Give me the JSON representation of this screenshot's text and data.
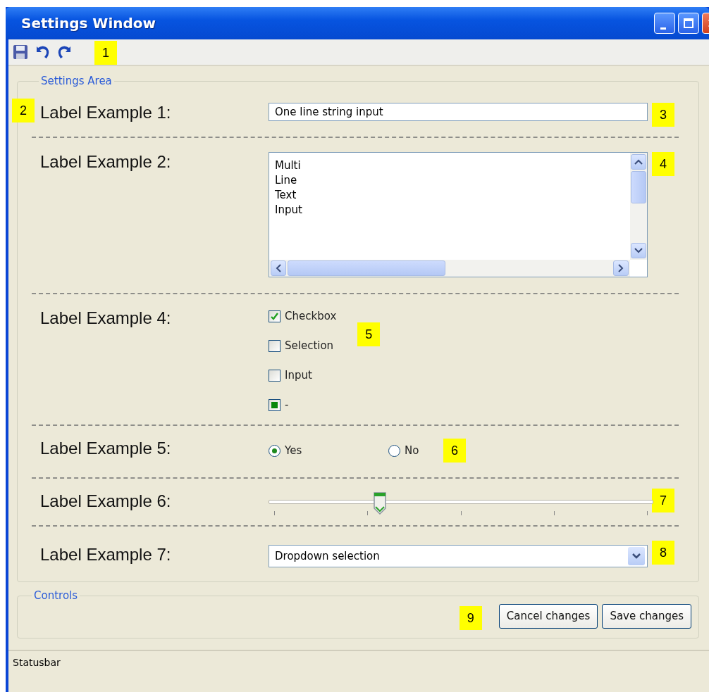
{
  "window": {
    "title": "Settings Window"
  },
  "toolbar": {
    "callout": "1"
  },
  "settings_area": {
    "legend": "Settings Area",
    "callout": "2",
    "rows": [
      {
        "kind": "text",
        "label": "Label Example 1:",
        "value": "One line string input",
        "callout": "3"
      },
      {
        "kind": "textarea",
        "label": "Label Example 2:",
        "value": "Multi\nLine\nText\nInput",
        "callout": "4"
      },
      {
        "kind": "checkboxes",
        "label": "Label Example 4:",
        "callout": "5",
        "options": [
          {
            "label": "Checkbox",
            "checked": true,
            "indeterminate": false
          },
          {
            "label": "Selection",
            "checked": false,
            "indeterminate": false
          },
          {
            "label": "Input",
            "checked": false,
            "indeterminate": false
          },
          {
            "label": "-",
            "checked": false,
            "indeterminate": true
          }
        ]
      },
      {
        "kind": "radios",
        "label": "Label Example 5:",
        "callout": "6",
        "options": [
          {
            "label": "Yes",
            "selected": true
          },
          {
            "label": "No",
            "selected": false
          }
        ]
      },
      {
        "kind": "slider",
        "label": "Label Example 6:",
        "level": 0.29,
        "callout": "7"
      },
      {
        "kind": "dropdown",
        "label": "Label Example 7:",
        "value": "Dropdown selection",
        "callout": "8"
      }
    ]
  },
  "controls": {
    "legend": "Controls",
    "callout": "9",
    "buttons": [
      "Cancel changes",
      "Save changes"
    ]
  },
  "status_bar": "Statusbar"
}
